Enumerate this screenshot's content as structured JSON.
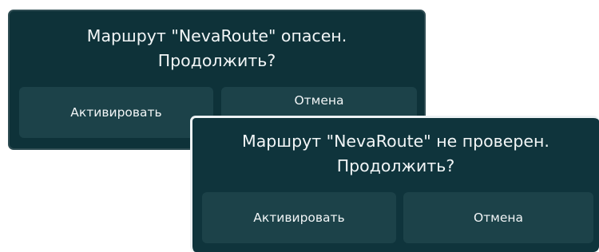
{
  "dialogs": [
    {
      "message_line1": "Маршрут \"NevaRoute\" опасен.",
      "message_line2": "Продолжить?",
      "confirm_label": "Активировать",
      "cancel_label": "Отмена"
    },
    {
      "message_line1": "Маршрут \"NevaRoute\" не проверен.",
      "message_line2": "Продолжить?",
      "confirm_label": "Активировать",
      "cancel_label": "Отмена"
    }
  ],
  "colors": {
    "dialog_background": "#0e3239",
    "button_background": "#1c4249",
    "text": "#ffffff"
  }
}
